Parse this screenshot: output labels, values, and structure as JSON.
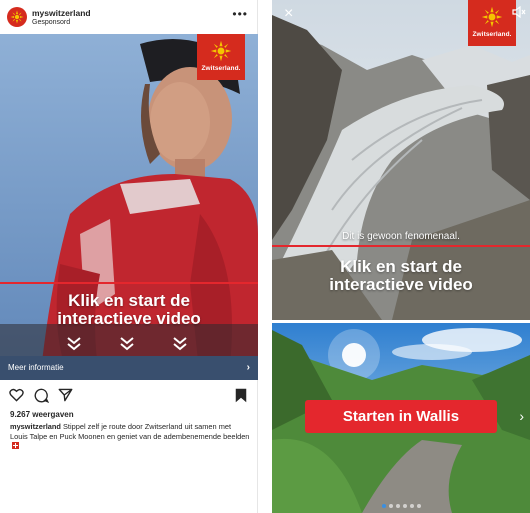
{
  "brand": {
    "name": "Zwitserland.",
    "accent_color": "#d52b1e",
    "line_color": "#e4272d"
  },
  "feed_post": {
    "account": "myswitzerland",
    "sponsored_label": "Gesponsord",
    "more_icon": "more-dots-icon",
    "video_title_line1": "Klik en start de",
    "video_title_line2": "interactieve video",
    "more_info_label": "Meer informatie",
    "more_info_arrow": "›",
    "views": "9.267 weergaven",
    "caption_account": "myswitzerland",
    "caption_text": "Stippel zelf je route door Zwitserland uit samen met Louis Talpe en Puck Moonen en geniet van de adembenemende beelden",
    "actions": [
      "like-icon",
      "comment-icon",
      "share-icon",
      "bookmark-icon"
    ]
  },
  "story": {
    "close_label": "×",
    "sound_icon": "sound-muted-icon",
    "caption": "Dit is gewoon fenomenaal.",
    "title_line1": "Klik en start de",
    "title_line2": "interactieve video",
    "cta_label": "Starten in Wallis",
    "next_arrow": "›",
    "dots_total": 6,
    "dots_active_index": 0
  }
}
